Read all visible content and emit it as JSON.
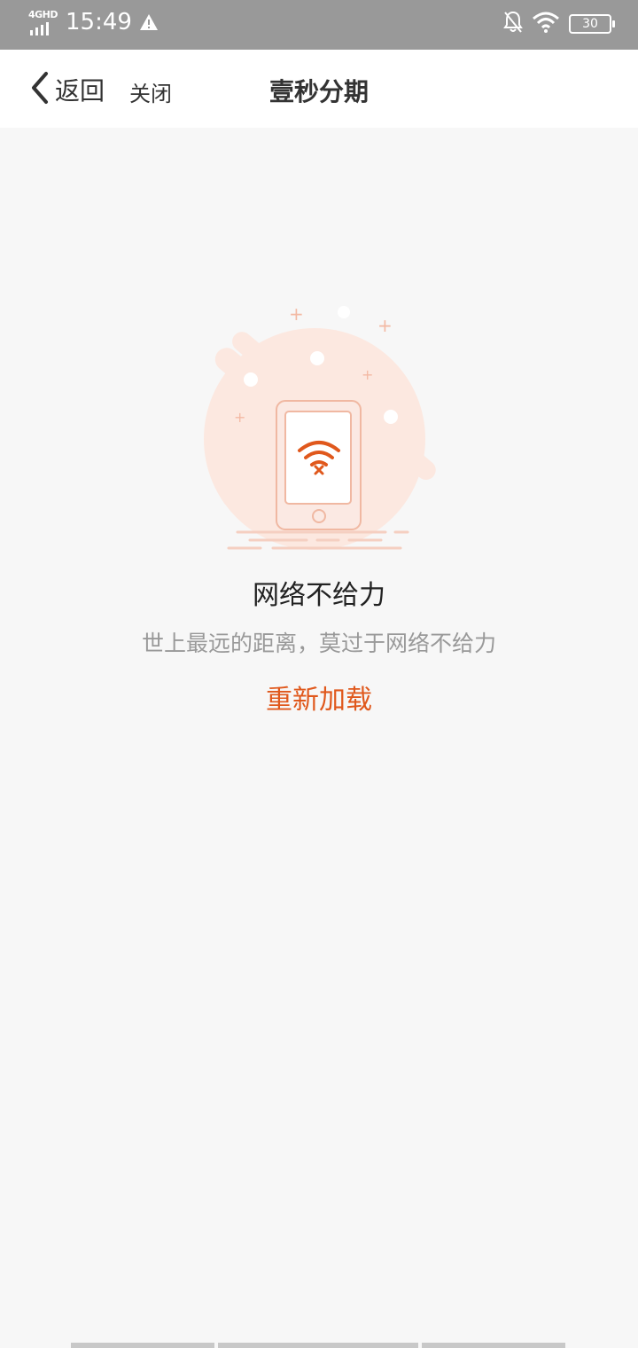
{
  "status_bar": {
    "network_label": "4GHD",
    "time": "15:49",
    "battery": "30"
  },
  "nav": {
    "back_label": "返回",
    "close_label": "关闭",
    "title": "壹秒分期"
  },
  "error": {
    "title": "网络不给力",
    "subtitle": "世上最远的距离，莫过于网络不给力",
    "reload_label": "重新加载"
  },
  "colors": {
    "accent": "#e0581c",
    "status_bar": "#999999",
    "background": "#f7f7f7"
  },
  "icons": [
    "back-chevron-icon",
    "warning-icon",
    "bell-off-icon",
    "wifi-icon",
    "battery-icon",
    "no-network-phone-illustration"
  ]
}
